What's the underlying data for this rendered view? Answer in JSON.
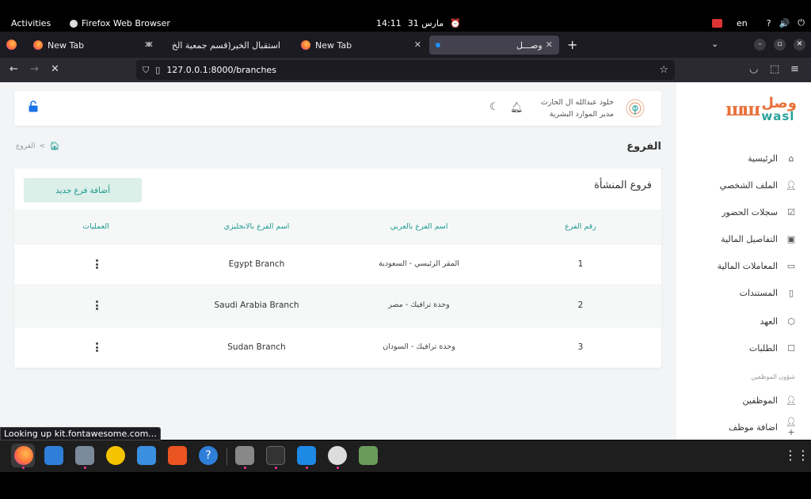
{
  "system_bar": {
    "activities": "Activities",
    "app_name": "Firefox Web Browser",
    "time": "14:11",
    "date": "31 مارس",
    "keyboard_layout": "en"
  },
  "browser": {
    "tabs": [
      {
        "label": "New Tab",
        "active": false
      },
      {
        "label": "استقبال الخير(قسم جمعية الخ",
        "active": false
      },
      {
        "label": "New Tab",
        "active": false
      },
      {
        "label": "وصـــل",
        "active": true
      }
    ],
    "url": "127.0.0.1:8000/branches",
    "status_tooltip": "Looking up kit.fontawesome.com..."
  },
  "app": {
    "logo_ar": "وصل",
    "logo_en": "wasl",
    "user_name": "خلود عبدالله ال الحارث",
    "user_role": "مدير الموارد البشرية"
  },
  "sidebar": {
    "items": [
      {
        "label": "الرئيسية",
        "icon": "home-outline-icon"
      },
      {
        "label": "الملف الشخصي",
        "icon": "user-icon"
      },
      {
        "label": "سجلات الحضور",
        "icon": "calendar-check-icon"
      },
      {
        "label": "التفاصيل المالية",
        "icon": "money-icon"
      },
      {
        "label": "المعاملات المالية",
        "icon": "credit-card-icon"
      },
      {
        "label": "المستندات",
        "icon": "document-icon"
      },
      {
        "label": "العهد",
        "icon": "box-icon"
      },
      {
        "label": "الطلبات",
        "icon": "clipboard-icon"
      }
    ],
    "section_label": "شؤون الموظفين",
    "section_items": [
      {
        "label": "الموظفين",
        "icon": "user-icon"
      },
      {
        "label": "اضافة موظف",
        "icon": "user-plus-icon"
      }
    ]
  },
  "page": {
    "title": "الفروع",
    "breadcrumb": "الفروع"
  },
  "branches": {
    "card_title": "فروع المنشأة",
    "add_button": "أضافة فرع جديد",
    "columns": {
      "number": "رقم الفرع",
      "name_ar": "اسم الفرع بالعربي",
      "name_en": "اسم الفرع بالانجليزي",
      "actions": "العمليات"
    },
    "rows": [
      {
        "number": "1",
        "name_ar": "المقر الرئيسي - السعودية",
        "name_en": "Egypt Branch"
      },
      {
        "number": "2",
        "name_ar": "وحدة ترافيك - مصر",
        "name_en": "Saudi Arabia Branch"
      },
      {
        "number": "3",
        "name_ar": "وحدة ترافيك - السودان",
        "name_en": "Sudan Branch"
      }
    ]
  }
}
